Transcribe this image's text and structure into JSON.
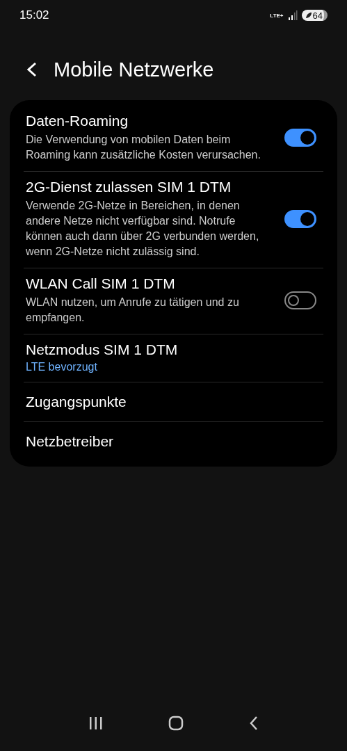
{
  "status_bar": {
    "time": "15:02",
    "network": "LTE+",
    "battery": "64"
  },
  "header": {
    "title": "Mobile Netzwerke"
  },
  "settings": [
    {
      "kind": "toggle",
      "title": "Daten-Roaming",
      "description": "Die Verwendung von mobilen Daten beim Roaming kann zusätzliche Kosten verursachen.",
      "on": true
    },
    {
      "kind": "toggle",
      "title": "2G-Dienst zulassen SIM 1 DTM",
      "description": "Verwende 2G-Netze in Bereichen, in denen andere Netze nicht verfügbar sind. Notrufe können auch dann über 2G verbunden werden, wenn 2G-Netze nicht zulässig sind.",
      "on": true
    },
    {
      "kind": "toggle",
      "title": "WLAN Call SIM 1 DTM",
      "description": "WLAN nutzen, um Anrufe zu tätigen und zu empfangen.",
      "on": false
    },
    {
      "kind": "value",
      "title": "Netzmodus SIM 1 DTM",
      "value": "LTE bevorzugt"
    },
    {
      "kind": "plain",
      "title": "Zugangspunkte"
    },
    {
      "kind": "plain",
      "title": "Netzbetreiber"
    }
  ]
}
